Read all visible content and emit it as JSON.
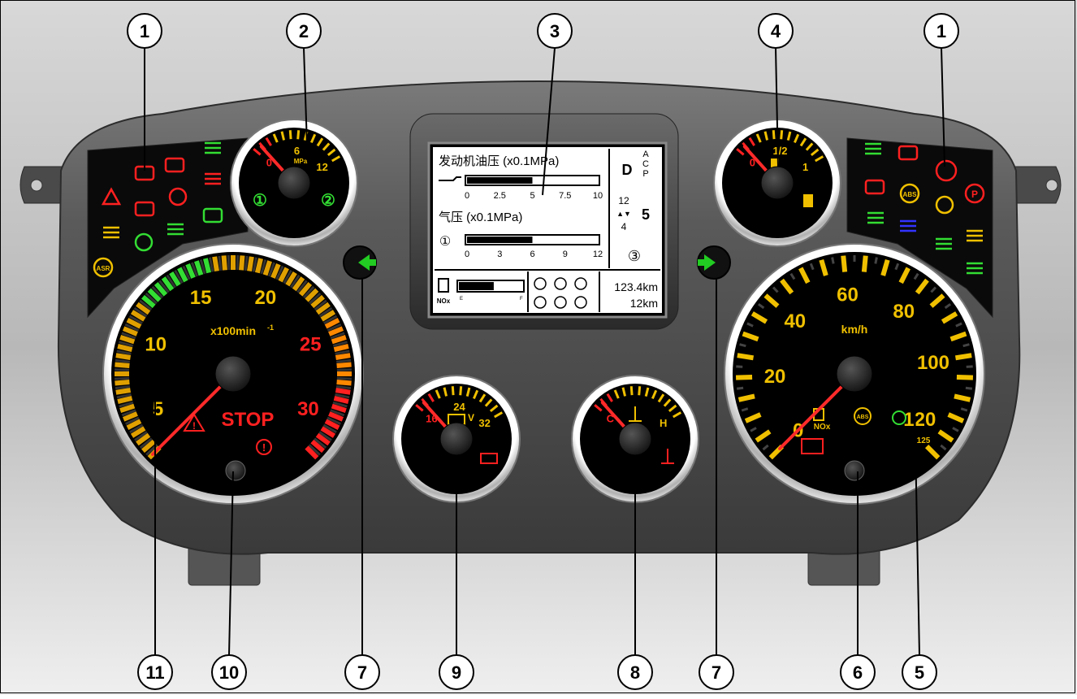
{
  "callouts": {
    "top": [
      "1",
      "2",
      "3",
      "4",
      "1"
    ],
    "bottom": [
      "11",
      "10",
      "7",
      "9",
      "8",
      "7",
      "6",
      "5"
    ]
  },
  "screen": {
    "oil_title": "发动机油压 (x0.1MPa)",
    "oil_ticks": [
      "0",
      "2.5",
      "5",
      "7.5",
      "10"
    ],
    "oil_level": 0.5,
    "air_title": "气压 (x0.1MPa)",
    "air_ticks": [
      "0",
      "3",
      "6",
      "9",
      "12"
    ],
    "air_level": 0.5,
    "gear": "D",
    "modes": [
      "A",
      "C",
      "P"
    ],
    "gear_top": "12",
    "gear_arrow": "▲▼",
    "gear_bottom": "4",
    "gear_current": "5",
    "circuit_1": "①",
    "circuit_3": "③",
    "fuel_label": "NOx",
    "fuel_e": "E",
    "fuel_f": "F",
    "fuel_level": 0.55,
    "odo_total": "123.4km",
    "odo_trip": "12km"
  },
  "tacho": {
    "ticks": [
      "5",
      "10",
      "15",
      "20",
      "25",
      "30"
    ],
    "unit": "x100min",
    "unit_sup": "-1",
    "stop": "STOP",
    "needle_value": 0
  },
  "speedo": {
    "ticks": [
      "0",
      "20",
      "40",
      "60",
      "80",
      "100",
      "120"
    ],
    "unit": "km/h",
    "max_mark": "125",
    "needle_value": 0,
    "nox_label": "NOx",
    "abs_label": "ABS"
  },
  "air_gauge": {
    "ticks": [
      "0",
      "6",
      "12"
    ],
    "unit": "MPa",
    "circuit_1": "①",
    "circuit_2": "②"
  },
  "fuel_gauge": {
    "ticks": [
      "0",
      "1/2",
      "1"
    ]
  },
  "volt_gauge": {
    "ticks": [
      "16",
      "24",
      "32"
    ],
    "unit": "V"
  },
  "temp_gauge": {
    "ticks": [
      "C",
      "H"
    ]
  },
  "left_warnings": {
    "asr": "ASR"
  },
  "right_warnings": {
    "abs": "ABS",
    "parking": "P"
  },
  "colors": {
    "red": "#ff2020",
    "green": "#33dd33",
    "yellow": "#f0c000",
    "orange": "#ff8800",
    "blue": "#3333ff",
    "needle": "#ff2a2a",
    "arrow_green": "#22cc22"
  }
}
